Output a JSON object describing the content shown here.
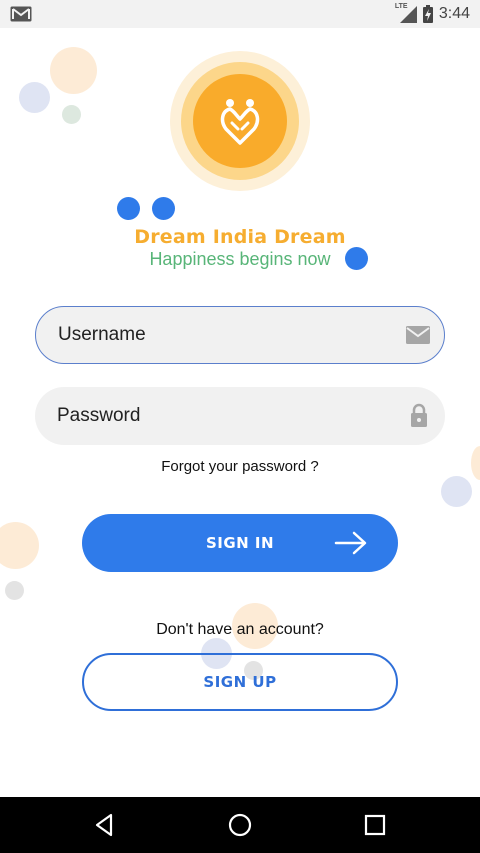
{
  "status_bar": {
    "left_icon": "gmail-notification-icon",
    "network": "LTE",
    "battery_icon": "battery-charging-icon",
    "time": "3:44"
  },
  "app": {
    "logo_icon": "couple-heart-logo-icon",
    "brand_title": "Dream India Dream",
    "brand_tagline": "Happiness begins now",
    "colors": {
      "accent_blue": "#2f7bea",
      "brand_orange": "#f6ad30",
      "tagline_green": "#58b578"
    }
  },
  "login_form": {
    "username_placeholder": "Username",
    "username_value": "",
    "username_icon": "envelope-icon",
    "password_placeholder": "Password",
    "password_value": "",
    "password_icon": "lock-icon",
    "forgot_password": "Forgot your password ?",
    "sign_in_label": "SIGN IN",
    "sign_in_icon": "arrow-right-icon",
    "no_account_text": "Don't have an account?",
    "sign_up_label": "SIGN UP"
  },
  "nav_bar": {
    "back_icon": "back-triangle-icon",
    "home_icon": "home-circle-icon",
    "recents_icon": "recents-square-icon"
  }
}
